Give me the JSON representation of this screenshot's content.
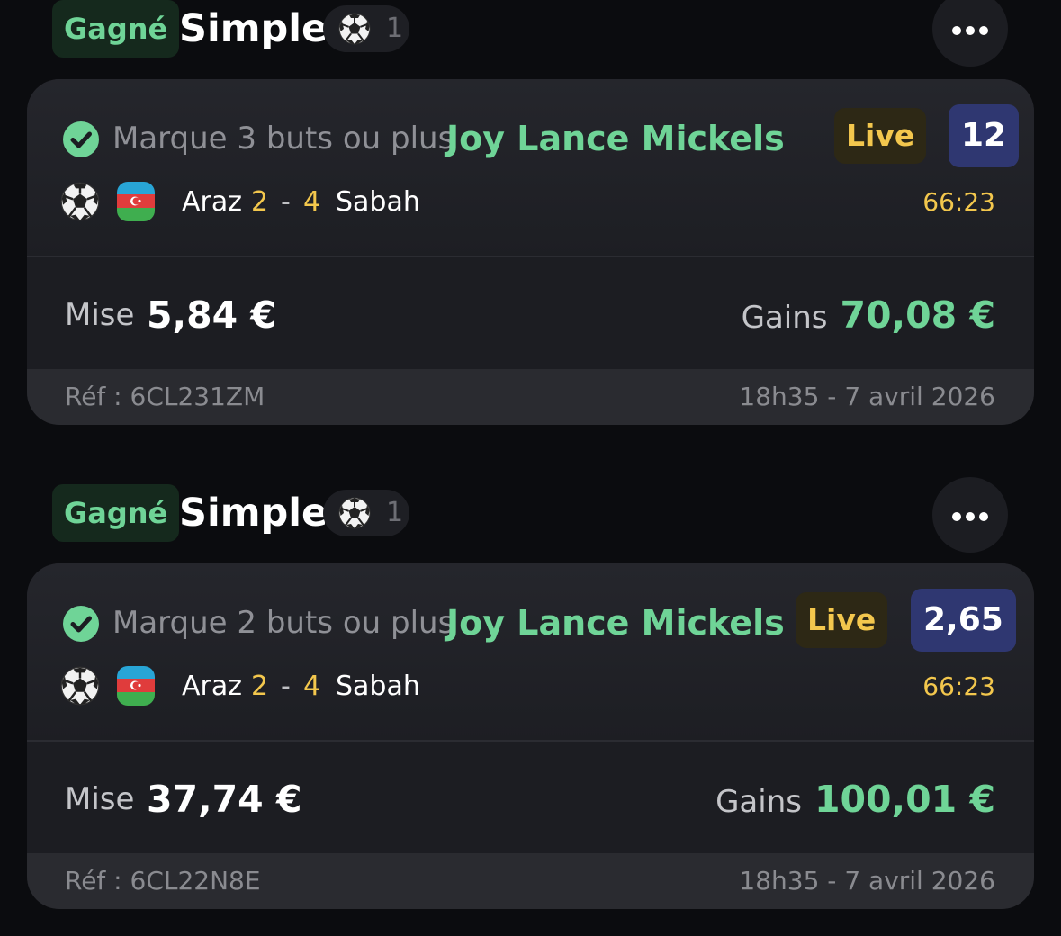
{
  "bets": [
    {
      "status": "Gagné",
      "type": "Simple",
      "sport_icon": "soccer-ball-icon",
      "selection_count": "1",
      "market": "Marque 3 buts ou plus",
      "player": "Joy Lance Mickels",
      "live": "Live",
      "odds": "12",
      "country_flag": "azerbaijan-flag-icon",
      "home_team": "Araz",
      "home_score": "2",
      "score_separator": "-",
      "away_score": "4",
      "away_team": "Sabah",
      "match_clock": "66:23",
      "stake_label": "Mise",
      "stake": "5,84 €",
      "gains_label": "Gains",
      "gains": "70,08 €",
      "reference": "Réf : 6CL231ZM",
      "placed_at": "18h35 - 7 avril 2026"
    },
    {
      "status": "Gagné",
      "type": "Simple",
      "sport_icon": "soccer-ball-icon",
      "selection_count": "1",
      "market": "Marque 2 buts ou plus",
      "player": "Joy Lance Mickels",
      "live": "Live",
      "odds": "2,65",
      "country_flag": "azerbaijan-flag-icon",
      "home_team": "Araz",
      "home_score": "2",
      "score_separator": "-",
      "away_score": "4",
      "away_team": "Sabah",
      "match_clock": "66:23",
      "stake_label": "Mise",
      "stake": "37,74 €",
      "gains_label": "Gains",
      "gains": "100,01 €",
      "reference": "Réf : 6CL22N8E",
      "placed_at": "18h35 - 7 avril 2026"
    }
  ],
  "colors": {
    "background": "#0b0c0f",
    "card": "#1c1d22",
    "win_green": "#6fd497",
    "live_yellow": "#f3c74d",
    "odds_blue": "#2f3771"
  }
}
